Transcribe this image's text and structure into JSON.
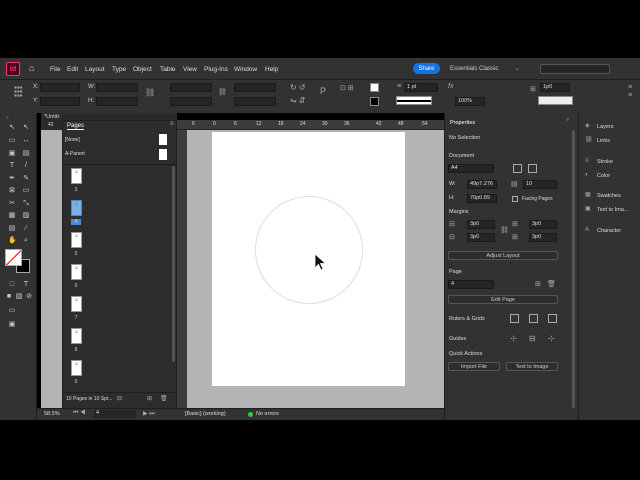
{
  "menubar": {
    "app_icon": "Id",
    "items": [
      "File",
      "Edit",
      "Layout",
      "Type",
      "Object",
      "Table",
      "View",
      "Plug-Ins",
      "Window",
      "Help"
    ],
    "share": "Share",
    "workspace": "Essentials Classic"
  },
  "control": {
    "x_label": "X:",
    "y_label": "Y:",
    "w_label": "W:",
    "h_label": "H:",
    "stroke_weight": "1 pt",
    "zoom": "100%",
    "opacity_value": "1p0"
  },
  "document": {
    "tab_title": "*Untitl-",
    "zoom_status": "58.5%",
    "page_field": "4",
    "preflight_profile": "[Basic] (working)",
    "errors": "No errors"
  },
  "ruler": {
    "ticks": [
      "6",
      "0",
      "6",
      "12",
      "18",
      "24",
      "30",
      "36",
      "42",
      "48",
      "54"
    ],
    "left_tick": "42"
  },
  "pages_panel": {
    "title": "Pages",
    "masters": [
      "[None]",
      "A-Parent"
    ],
    "page_numbers": [
      "3",
      "4",
      "5",
      "6",
      "7",
      "8",
      "9"
    ],
    "footer": "10 Pages in 10 Spr..."
  },
  "properties": {
    "title": "Properties",
    "selection": "No Selection",
    "document_label": "Document",
    "preset": "A4",
    "width": "49p7.276",
    "height": "70p0.89",
    "pages_count": "10",
    "facing_pages": "Facing Pages",
    "margins_label": "Margins",
    "margin_top": "3p0",
    "margin_bottom": "3p0",
    "margin_left": "3p0",
    "margin_right": "3p0",
    "adjust_layout": "Adjust Layout",
    "page_label": "Page",
    "page_value": "4",
    "edit_page": "Edit Page",
    "rulers_grids": "Rulers & Grids",
    "guides": "Guides",
    "quick_actions": "Quick Actions",
    "import_file": "Import File",
    "text_to_image": "Text to Image"
  },
  "dock": {
    "items": [
      "Layers",
      "Links",
      "Stroke",
      "Color",
      "Swatches",
      "Text to Ima...",
      "Character"
    ]
  }
}
